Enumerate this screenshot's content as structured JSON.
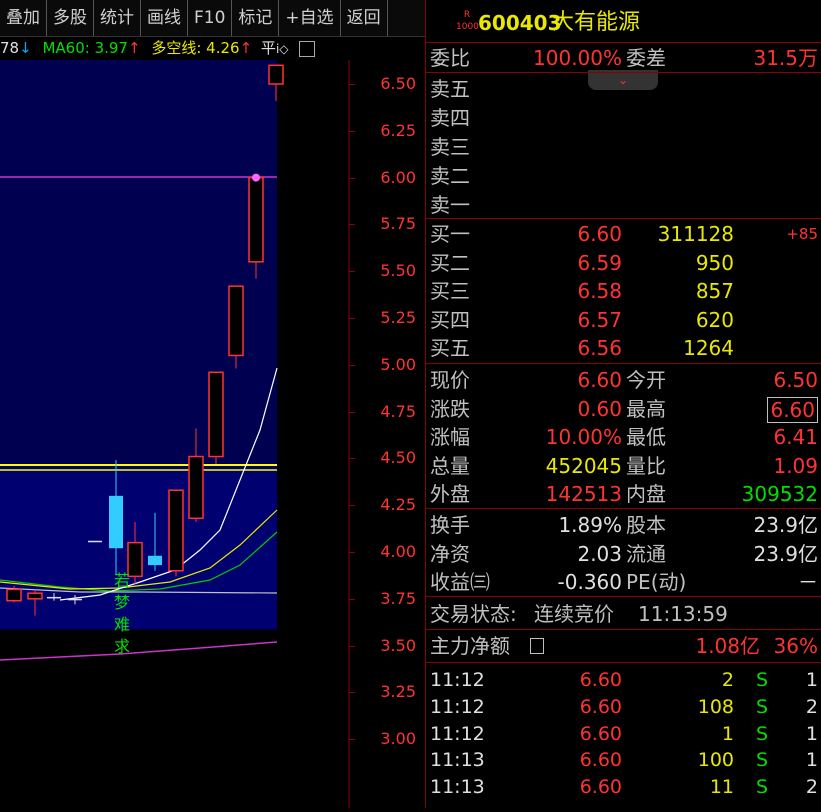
{
  "toolbar": {
    "items": [
      "叠加",
      "多股",
      "统计",
      "画线",
      "F10",
      "标记",
      "+自选",
      "返回"
    ]
  },
  "ma_bar": {
    "cut": "78",
    "ma60_label": "MA60: 3.97",
    "dk_label": "多空线: 4.26",
    "flat": "平"
  },
  "chart": {
    "price_ticks": [
      "6.50",
      "6.25",
      "6.00",
      "5.75",
      "5.50",
      "5.25",
      "5.00",
      "4.75",
      "4.50",
      "4.25",
      "4.00",
      "3.75",
      "3.50",
      "3.25",
      "3.00"
    ],
    "annotation": [
      "若",
      "梦",
      "难",
      "求"
    ]
  },
  "chart_data": {
    "type": "candlestick",
    "y_ticks": [
      6.5,
      6.25,
      6.0,
      5.75,
      5.5,
      5.25,
      5.0,
      4.75,
      4.5,
      4.25,
      4.0,
      3.75,
      3.5,
      3.25,
      3.0
    ],
    "ma60": 3.97,
    "dk_line": 4.26
  },
  "stock": {
    "badge_top": "R",
    "badge_bottom": "1000",
    "code": "600403",
    "name": "大有能源"
  },
  "ratio": {
    "wb_label": "委比",
    "wb_value": "100.00%",
    "wc_label": "委差",
    "wc_value": "31.5万"
  },
  "collapse_icon": "chevron-down-icon",
  "sells": [
    "卖五",
    "卖四",
    "卖三",
    "卖二",
    "卖一"
  ],
  "buys": [
    {
      "label": "买一",
      "price": "6.60",
      "vol": "311128",
      "extra": "+85"
    },
    {
      "label": "买二",
      "price": "6.59",
      "vol": "950",
      "extra": ""
    },
    {
      "label": "买三",
      "price": "6.58",
      "vol": "857",
      "extra": ""
    },
    {
      "label": "买四",
      "price": "6.57",
      "vol": "620",
      "extra": ""
    },
    {
      "label": "买五",
      "price": "6.56",
      "vol": "1264",
      "extra": ""
    }
  ],
  "quote": [
    {
      "l1": "现价",
      "v1": "6.60",
      "l2": "今开",
      "v2": "6.50"
    },
    {
      "l1": "涨跌",
      "v1": "0.60",
      "l2": "最高",
      "v2": "6.60"
    },
    {
      "l1": "涨幅",
      "v1": "10.00%",
      "l2": "最低",
      "v2": "6.41"
    },
    {
      "l1": "总量",
      "v1": "452045",
      "l2": "量比",
      "v2": "1.09"
    },
    {
      "l1": "外盘",
      "v1": "142513",
      "l2": "内盘",
      "v2": "309532"
    }
  ],
  "fund": [
    {
      "l1": "换手",
      "v1": "1.89%",
      "l2": "股本",
      "v2": "23.9亿"
    },
    {
      "l1": "净资",
      "v1": "2.03",
      "l2": "流通",
      "v2": "23.9亿"
    },
    {
      "l1": "收益㈢",
      "v1": "-0.360",
      "l2": "PE(动)",
      "v2": "－"
    }
  ],
  "status": {
    "label": "交易状态:",
    "value": "连续竞价",
    "time": "11:13:59"
  },
  "main_flow": {
    "label": "主力净额",
    "value": "1.08亿",
    "pct": "36%"
  },
  "ticks": [
    {
      "t": "11:12",
      "p": "6.60",
      "v": "2",
      "d": "S",
      "n": "1"
    },
    {
      "t": "11:12",
      "p": "6.60",
      "v": "108",
      "d": "S",
      "n": "2"
    },
    {
      "t": "11:12",
      "p": "6.60",
      "v": "1",
      "d": "S",
      "n": "1"
    },
    {
      "t": "11:13",
      "p": "6.60",
      "v": "100",
      "d": "S",
      "n": "1"
    },
    {
      "t": "11:13",
      "p": "6.60",
      "v": "11",
      "d": "S",
      "n": "2"
    }
  ]
}
